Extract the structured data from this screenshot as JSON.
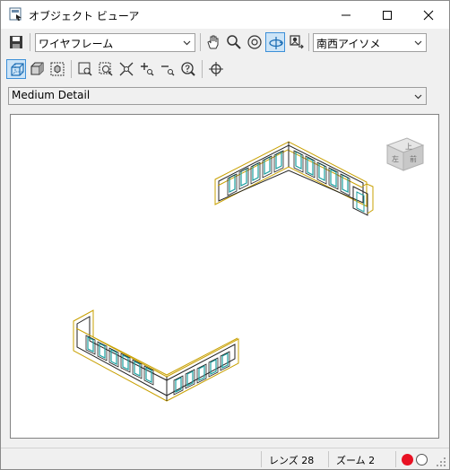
{
  "window": {
    "title": "オブジェクト ビューア",
    "icon": "object-viewer-icon"
  },
  "toolbar1": {
    "visual_style": "ワイヤフレーム",
    "view": "南西アイソメ",
    "icons": [
      "save-icon",
      "pan-hand-icon",
      "zoom-icon",
      "orbit-icon",
      "constrained-orbit-icon",
      "camera-icon"
    ]
  },
  "toolbar2": {
    "icons": [
      "wireframe-box-icon",
      "shaded-box-icon",
      "viewcube-icon",
      "zoom-window-icon",
      "zoom-realtime-icon",
      "zoom-extents-icon",
      "zoom-in-icon",
      "zoom-out-icon",
      "zoom-help-icon",
      "target-crosshair-icon"
    ]
  },
  "detail_level": "Medium Detail",
  "viewcube": {
    "face_top": "上",
    "face_left": "左",
    "face_front": "前"
  },
  "status": {
    "lens": "レンズ 28",
    "zoom": "ズーム 2"
  },
  "colors": {
    "accent": "#3c8fd8",
    "red_dot": "#e81123",
    "model_wall": "#c8a000",
    "window_frame": "#1aa0a0"
  }
}
